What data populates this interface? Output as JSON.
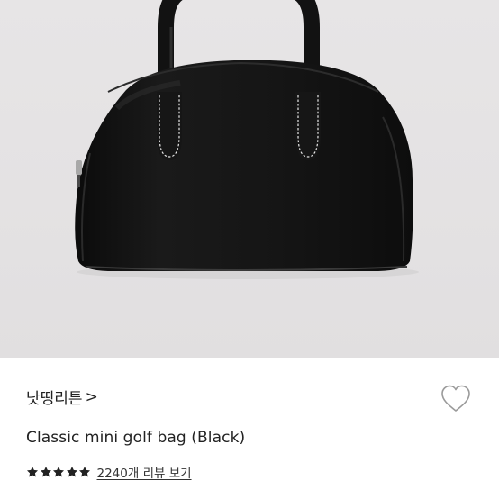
{
  "product": {
    "image_alt": "Black leather mini golf bag with white stitching",
    "brand": "낫띵리튼",
    "brand_chevron": ">",
    "title": "Classic mini golf bag (Black)",
    "rating": {
      "stars": 5,
      "star_color": "#222222",
      "review_link": "2240개 리뷰 보기"
    },
    "like_icon": "heart-outline-icon"
  },
  "colors": {
    "background": "#ffffff",
    "image_background": "#e4e2e3",
    "bag": "#141414",
    "stitching": "#e8e8e8",
    "text": "#222222"
  }
}
